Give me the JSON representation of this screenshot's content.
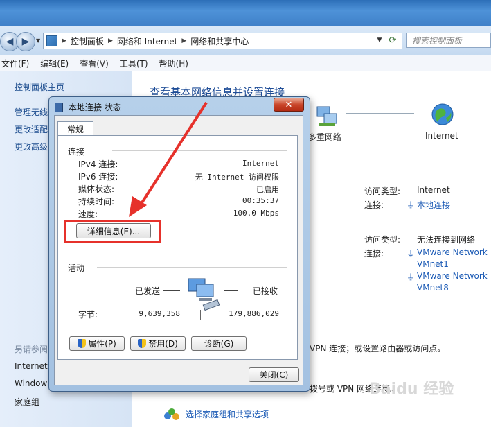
{
  "address_bar": {
    "crumbs": [
      "控制面板",
      "网络和 Internet",
      "网络和共享中心"
    ],
    "search_placeholder": "搜索控制面板"
  },
  "menu": [
    "文件(F)",
    "编辑(E)",
    "查看(V)",
    "工具(T)",
    "帮助(H)"
  ],
  "left_pane": {
    "items": [
      "控制面板主页",
      "管理无线",
      "更改适配",
      "更改高级"
    ],
    "see_also_heading": "另请参阅",
    "see_also": [
      "Internet",
      "Windows",
      "家庭组"
    ]
  },
  "main": {
    "title": "查看基本网络信息并设置连接",
    "map_labels": [
      "多重网络",
      "Internet"
    ],
    "network1": {
      "access_type_label": "访问类型:",
      "access_type_value": "Internet",
      "connection_label": "连接:",
      "connection_value": "本地连接"
    },
    "network2": {
      "access_type_label": "访问类型:",
      "access_type_value": "无法连接到网络",
      "connection_label": "连接:",
      "connection_values": [
        "VMware Network",
        "VMnet1",
        "VMware Network",
        "VMnet8"
      ]
    },
    "text_vpn1": "VPN 连接；或设置路由器或访问点。",
    "text_vpn2": "拨号或 VPN 网络连接。",
    "homegroup_link": "选择家庭组和共享选项"
  },
  "dialog": {
    "title": "本地连接 状态",
    "close_glyph": "✕",
    "tab": "常规",
    "connection_group": "连接",
    "rows": [
      {
        "key": "IPv4 连接:",
        "value": "Internet"
      },
      {
        "key": "IPv6 连接:",
        "value": "无 Internet 访问权限"
      },
      {
        "key": "媒体状态:",
        "value": "已启用"
      },
      {
        "key": "持续时间:",
        "value": "00:35:37"
      },
      {
        "key": "速度:",
        "value": "100.0 Mbps"
      }
    ],
    "details_button": "详细信息(E)...",
    "activity_group": "活动",
    "sent_label": "已发送",
    "received_label": "已接收",
    "bytes_label": "字节:",
    "bytes_sent": "9,639,358",
    "bytes_received": "179,886,029",
    "properties_button": "属性(P)",
    "disable_button": "禁用(D)",
    "diagnose_button": "诊断(G)",
    "close_button": "关闭(C)"
  },
  "watermark": "Baidu 经验",
  "colors": {
    "link": "#1b5ab5",
    "highlight": "#e6312b",
    "title_blue": "#1f4d97"
  }
}
